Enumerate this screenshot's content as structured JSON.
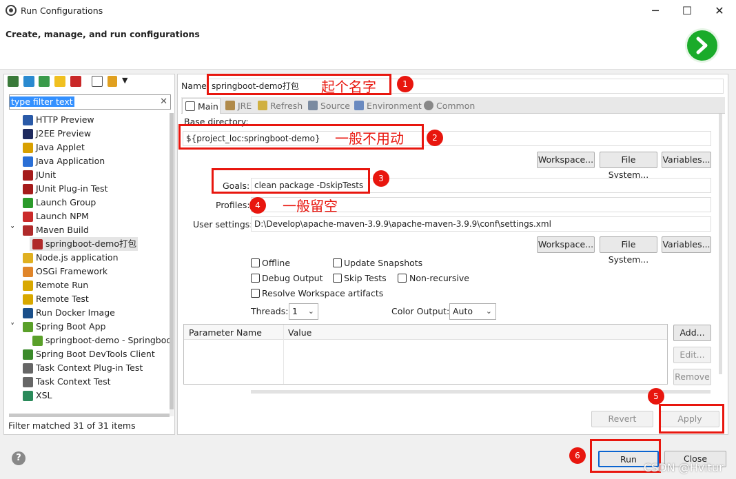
{
  "window": {
    "title": "Run Configurations",
    "minimize": "─",
    "maximize": "☐",
    "close": "✕"
  },
  "header": {
    "title": "Create, manage, and run configurations"
  },
  "sidebar": {
    "filter_value": "type filter text",
    "clear": "✕",
    "items": [
      {
        "label": "HTTP Preview",
        "icon": "http-preview-icon",
        "color": "#2a5aa8"
      },
      {
        "label": "J2EE Preview",
        "icon": "j2ee-preview-icon",
        "color": "#1e2a5e"
      },
      {
        "label": "Java Applet",
        "icon": "java-applet-icon",
        "color": "#d8a000"
      },
      {
        "label": "Java Application",
        "icon": "java-application-icon",
        "color": "#2a6fd6"
      },
      {
        "label": "JUnit",
        "icon": "junit-icon",
        "color": "#a51b1b"
      },
      {
        "label": "JUnit Plug-in Test",
        "icon": "junit-plugin-icon",
        "color": "#a51b1b"
      },
      {
        "label": "Launch Group",
        "icon": "launch-group-icon",
        "color": "#2a9a2a"
      },
      {
        "label": "Launch NPM",
        "icon": "npm-icon",
        "color": "#cb2a2a"
      },
      {
        "label": "Maven Build",
        "icon": "maven-icon",
        "color": "#b02a2a",
        "expanded": "˅"
      },
      {
        "label": "springboot-demo打包",
        "icon": "maven-config-icon",
        "color": "#b02a2a",
        "child": true,
        "selected": true
      },
      {
        "label": "Node.js application",
        "icon": "nodejs-icon",
        "color": "#e0b020"
      },
      {
        "label": "OSGi Framework",
        "icon": "osgi-icon",
        "color": "#e0852a"
      },
      {
        "label": "Remote Run",
        "icon": "remote-run-icon",
        "color": "#d8a800"
      },
      {
        "label": "Remote Test",
        "icon": "remote-test-icon",
        "color": "#d8a800"
      },
      {
        "label": "Run Docker Image",
        "icon": "docker-icon",
        "color": "#1a4f8a"
      },
      {
        "label": "Spring Boot App",
        "icon": "spring-boot-icon",
        "color": "#5aa02a",
        "expanded": "˅"
      },
      {
        "label": "springboot-demo - Springboot",
        "icon": "spring-config-icon",
        "color": "#5aa02a",
        "child": true
      },
      {
        "label": "Spring Boot DevTools Client",
        "icon": "devtools-icon",
        "color": "#3a8a2a"
      },
      {
        "label": "Task Context Plug-in Test",
        "icon": "task-plugin-icon",
        "color": "#666666"
      },
      {
        "label": "Task Context Test",
        "icon": "task-test-icon",
        "color": "#666666"
      },
      {
        "label": "XSL",
        "icon": "xsl-icon",
        "color": "#2a8a5a"
      }
    ],
    "status": "Filter matched 31 of 31 items"
  },
  "form": {
    "name_label": "Name:",
    "name_value": "springboot-demo打包",
    "tabs": [
      {
        "label": "Main",
        "icon": "main-tab-icon"
      },
      {
        "label": "JRE",
        "icon": "jre-tab-icon"
      },
      {
        "label": "Refresh",
        "icon": "refresh-tab-icon"
      },
      {
        "label": "Source",
        "icon": "source-tab-icon"
      },
      {
        "label": "Environment",
        "icon": "environment-tab-icon"
      },
      {
        "label": "Common",
        "icon": "common-tab-icon"
      }
    ],
    "base_dir_label": "Base directory:",
    "base_dir_value": "${project_loc:springboot-demo}",
    "workspace_btn": "Workspace...",
    "filesystem_btn": "File System...",
    "variables_btn": "Variables...",
    "goals_label": "Goals:",
    "goals_value": "clean package -DskipTests",
    "profiles_label": "Profiles:",
    "profiles_value": "",
    "user_settings_label": "User settings:",
    "user_settings_value": "D:\\Develop\\apache-maven-3.9.9\\apache-maven-3.9.9\\conf\\settings.xml",
    "offline": "Offline",
    "update_snapshots": "Update Snapshots",
    "debug_output": "Debug Output",
    "skip_tests": "Skip Tests",
    "non_recursive": "Non-recursive",
    "resolve_workspace": "Resolve Workspace artifacts",
    "threads_label": "Threads:",
    "threads_value": "1",
    "color_output_label": "Color Output:",
    "color_output_value": "Auto",
    "param_name_header": "Parameter Name",
    "param_value_header": "Value",
    "add_btn": "Add...",
    "edit_btn": "Edit...",
    "remove_btn": "Remove",
    "revert_btn": "Revert",
    "apply_btn": "Apply"
  },
  "footer": {
    "help": "?",
    "run_btn": "Run",
    "close_btn": "Close"
  },
  "annotations": {
    "n1": "1",
    "t1": "起个名字",
    "n2": "2",
    "t2": "一般不用动",
    "n3": "3",
    "n4": "4",
    "t4": "一般留空",
    "n5": "5",
    "n6": "6"
  },
  "watermark": "CSDN @Hvitur",
  "accent": "#e8160e"
}
